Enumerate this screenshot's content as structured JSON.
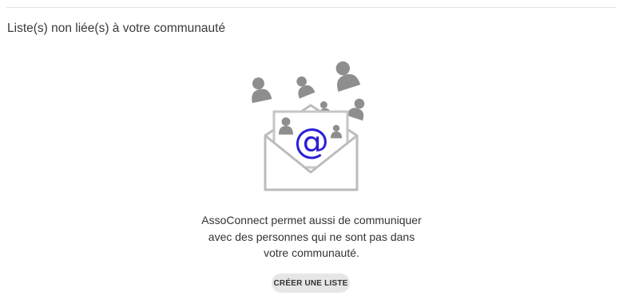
{
  "section": {
    "title": "Liste(s) non liée(s) à votre communauté"
  },
  "illustration": {
    "icon": "email-envelope-with-people-icon",
    "at_symbol": "@",
    "accent_color": "#2a1fd6",
    "shape_color": "#8e8e8e"
  },
  "empty_state": {
    "message_lines": [
      "AssoConnect permet aussi de communiquer",
      "avec des personnes qui ne sont pas dans",
      "votre communauté."
    ]
  },
  "actions": {
    "create_list_label": "CRÉER UNE LISTE"
  }
}
